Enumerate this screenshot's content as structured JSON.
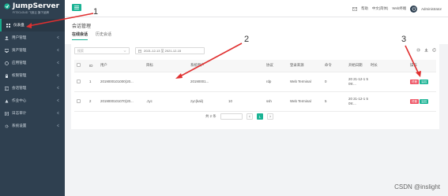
{
  "brand": {
    "title": "JumpServer",
    "subtitle": "FIT2CLOUD 飞致云 旗下品牌"
  },
  "sidebar": {
    "items": [
      {
        "label": "仪表盘",
        "icon": "dashboard-icon",
        "active": true
      },
      {
        "label": "用户管理",
        "icon": "users-icon"
      },
      {
        "label": "资产管理",
        "icon": "assets-icon"
      },
      {
        "label": "应用管理",
        "icon": "apps-icon"
      },
      {
        "label": "权限管理",
        "icon": "permission-icon"
      },
      {
        "label": "会话管理",
        "icon": "session-icon"
      },
      {
        "label": "作业中心",
        "icon": "jobs-icon"
      },
      {
        "label": "日志审计",
        "icon": "audit-icon"
      },
      {
        "label": "系统设置",
        "icon": "settings-icon"
      }
    ]
  },
  "topbar": {
    "help": "帮助",
    "language": "中文(简体)",
    "web_terminal": "Web终端",
    "user": "Administrator"
  },
  "page": {
    "title": "会话管理",
    "tabs": [
      "在线会话",
      "历史会话"
    ]
  },
  "filters": {
    "select_placeholder": "搜索",
    "date_range": "2021-12-13 至 2021-12-15"
  },
  "table": {
    "columns": [
      "",
      "ID",
      "用户",
      "目标",
      "系统用户",
      "",
      "协议",
      "登录来源",
      "命令",
      "开始日期",
      "时长",
      "",
      "操作"
    ],
    "rows": [
      {
        "id": "1",
        "user": "2019000101000(20...",
        "target": "",
        "system_user": "20190001...",
        "extra": "",
        "protocol": "rdp",
        "source": "Web Terminal",
        "commands": "0",
        "start": "20 21-12-1 5 09:...",
        "duration": "",
        "actions": [
          "终断",
          "监控"
        ]
      },
      {
        "id": "2",
        "user": "2019000101070(20...",
        "target": ".zyc",
        "system_user": "zyc(kali)",
        "extra": "10",
        "protocol": "ssh",
        "source": "Web Terminal",
        "commands": "5",
        "start": "20 21-12-1 5 09:...",
        "duration": "",
        "actions": [
          "终断",
          "监控"
        ]
      }
    ]
  },
  "pagination": {
    "total": "共 2 条",
    "current": "1"
  },
  "annotations": [
    "1",
    "2",
    "3"
  ],
  "watermark": "CSDN @inslight",
  "colors": {
    "sidebar": "#2f4050",
    "accent": "#1ab394",
    "danger": "#ed5565",
    "annotation": "#e03030"
  }
}
